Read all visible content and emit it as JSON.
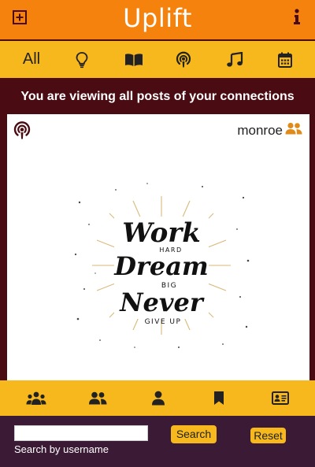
{
  "app": {
    "title": "Uplift"
  },
  "header": {
    "add_icon": "plus-square-icon",
    "info_icon": "info-icon"
  },
  "filters": [
    {
      "label": "All",
      "name": "filter-all"
    },
    {
      "icon": "lightbulb-icon",
      "name": "filter-ideas"
    },
    {
      "icon": "book-icon",
      "name": "filter-books"
    },
    {
      "icon": "podcast-icon",
      "name": "filter-podcasts"
    },
    {
      "icon": "music-icon",
      "name": "filter-music"
    },
    {
      "icon": "calendar-icon",
      "name": "filter-events"
    }
  ],
  "banner": {
    "text": "You are viewing all posts of your connections"
  },
  "post": {
    "type_icon": "podcast-icon",
    "author": "monroe",
    "author_icon": "connections-icon",
    "art_text": {
      "line1": "Work",
      "line2": "HARD",
      "line3": "Dream",
      "line4": "BIG",
      "line5": "Never",
      "line6": "GIVE UP"
    }
  },
  "bottom_nav": [
    {
      "icon": "groups-icon",
      "name": "nav-groups"
    },
    {
      "icon": "connections-icon",
      "name": "nav-connections"
    },
    {
      "icon": "profile-icon",
      "name": "nav-profile"
    },
    {
      "icon": "bookmark-icon",
      "name": "nav-bookmarks"
    },
    {
      "icon": "id-card-icon",
      "name": "nav-contacts"
    }
  ],
  "search": {
    "input_value": "",
    "hint": "Search by username",
    "search_label": "Search",
    "reset_label": "Reset"
  },
  "colors": {
    "header": "#f5820d",
    "bar": "#f6b81d",
    "maroon": "#4a0c12",
    "footer": "#3b1a35",
    "accent_icon": "#e08a1a",
    "podcast_icon": "#4a0c12"
  }
}
